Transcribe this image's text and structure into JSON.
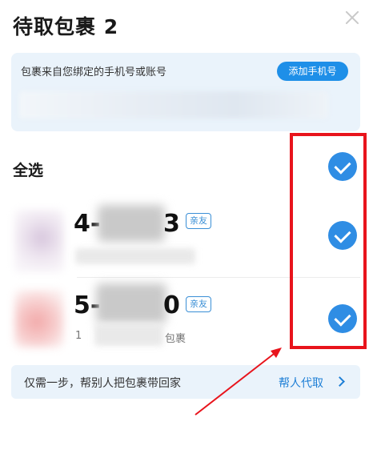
{
  "header": {
    "title": "待取包裹 2",
    "close_icon": "close-icon"
  },
  "bind_card": {
    "text": "包裹来自您绑定的手机号或账号",
    "add_phone_label": "添加手机号"
  },
  "select_all": {
    "label": "全选",
    "checked": true
  },
  "packages": [
    {
      "code_start": "4-",
      "code_end": "3",
      "tag": "亲友",
      "checked": true,
      "desc_start": "",
      "desc_end": ""
    },
    {
      "code_start": "5-",
      "code_end": "0",
      "tag": "亲友",
      "checked": true,
      "desc_start": "1",
      "desc_end": "包裹"
    }
  ],
  "helper": {
    "text": "仅需一步，帮别人把包裹带回家",
    "link_label": "帮人代取"
  },
  "colors": {
    "accent": "#2f8de4",
    "annotation": "#e8141c",
    "card_bg": "#eaf3fb"
  }
}
